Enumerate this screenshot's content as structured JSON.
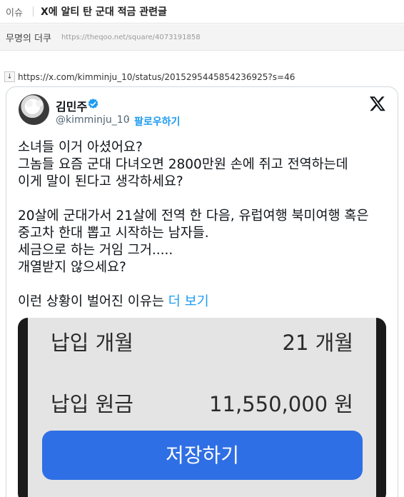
{
  "post": {
    "category": "이슈",
    "title": "X에 알티 탄 군대 적금 관련글",
    "author": "무명의 더쿠",
    "url": "https://theqoo.net/square/4073191858"
  },
  "link": {
    "icon": "↓",
    "url": "https://x.com/kimminju_10/status/2015295445854236925?s=46"
  },
  "tweet": {
    "display_name": "김민주",
    "handle": "@kimminju_10",
    "separator": "·",
    "follow_label": "팔로우하기",
    "lines": [
      "소녀들 이거 아셨어요?",
      "그놈들 요즘 군대 다녀오면 2800만원 손에 쥐고 전역하는데",
      "이게 말이 된다고 생각하세요?",
      "",
      "20살에 군대가서 21살에 전역 한 다음, 유럽여행 북미여행 혹은",
      "중고차 한대 뽑고 시작하는 남자들.",
      "세금으로 하는 거임 그거.....",
      "개열받지 않으세요?",
      "",
      "이런 상황이 벌어진 이유는"
    ],
    "more_label": "더 보기",
    "verified_color": "#1d9bf0",
    "link_color": "#1d9bf0"
  },
  "media": {
    "rows": [
      {
        "label": "납입 개월",
        "value": "21 개월"
      },
      {
        "label": "납입 원금",
        "value": "11,550,000 원"
      }
    ],
    "button_label": "저장하기",
    "button_color": "#2f6fe5"
  }
}
